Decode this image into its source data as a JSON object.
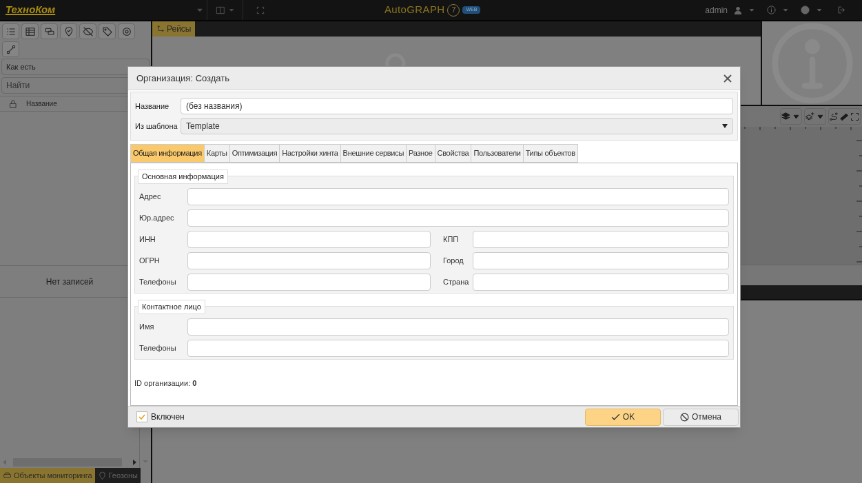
{
  "header": {
    "logo": "ТехноКом",
    "brand": "AutoGRAPH",
    "version": "7",
    "badge": "WEB",
    "user": "admin"
  },
  "left_panel": {
    "sort_field": {
      "value": "Как есть"
    },
    "search_field": {
      "placeholder": "Найти"
    },
    "column": "Название",
    "empty_text": "Нет записей",
    "tabs": [
      {
        "label": "Объекты мониторинга",
        "selected": true
      },
      {
        "label": "Геозоны",
        "selected": false
      }
    ]
  },
  "content_tabs": [
    {
      "label": "Рейсы",
      "selected": true
    }
  ],
  "dialog": {
    "title": "Организация: Создать",
    "name_field": {
      "label": "Название",
      "value": "(без названия)"
    },
    "template_field": {
      "label": "Из шаблона",
      "value": "Template"
    },
    "tabs": [
      {
        "label": "Общая информация",
        "selected": true
      },
      {
        "label": "Карты",
        "selected": false
      },
      {
        "label": "Оптимизация",
        "selected": false
      },
      {
        "label": "Настройки хинта",
        "selected": false
      },
      {
        "label": "Внешние сервисы",
        "selected": false
      },
      {
        "label": "Разное",
        "selected": false
      },
      {
        "label": "Свойства",
        "selected": false
      },
      {
        "label": "Пользователи",
        "selected": false
      },
      {
        "label": "Типы объектов",
        "selected": false
      }
    ],
    "groups": [
      {
        "title": "Основная информация",
        "rows": [
          [
            {
              "label": "Адрес"
            }
          ],
          [
            {
              "label": "Юр.адрес"
            }
          ],
          [
            {
              "label": "ИНН"
            },
            {
              "label": "КПП"
            }
          ],
          [
            {
              "label": "ОГРН"
            },
            {
              "label": "Город"
            }
          ],
          [
            {
              "label": "Телефоны"
            },
            {
              "label": "Страна"
            }
          ]
        ]
      },
      {
        "title": "Контактное лицо",
        "rows": [
          [
            {
              "label": "Имя"
            }
          ],
          [
            {
              "label": "Телефоны"
            }
          ]
        ]
      }
    ],
    "id_text": "ID организации: **0**",
    "enabled": {
      "label": "Включен",
      "checked": true
    },
    "buttons": [
      {
        "label": "OK",
        "kind": "primary"
      },
      {
        "label": "Отмена",
        "kind": "cancel"
      }
    ]
  }
}
